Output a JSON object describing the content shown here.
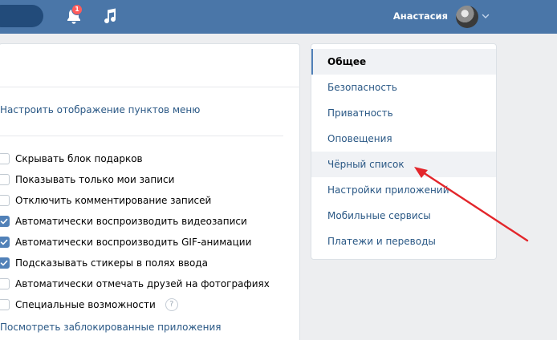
{
  "header": {
    "search_icon": "search-field",
    "notification_count": "1",
    "user_name": "Анастасия",
    "colors": {
      "bar": "#4a76a8",
      "badge": "#ff5c5c"
    }
  },
  "left_panel": {
    "menu_config_link": "Настроить отображение пунктов меню",
    "options": [
      {
        "label": "Скрывать блок подарков",
        "checked": false
      },
      {
        "label": "Показывать только мои записи",
        "checked": false
      },
      {
        "label": "Отключить комментирование записей",
        "checked": false
      },
      {
        "label": "Автоматически воспроизводить видеозаписи",
        "checked": true
      },
      {
        "label": "Автоматически воспроизводить GIF-анимации",
        "checked": true
      },
      {
        "label": "Подсказывать стикеры в полях ввода",
        "checked": true
      },
      {
        "label": "Автоматически отмечать друзей на фотографиях",
        "checked": false
      },
      {
        "label": "Специальные возможности",
        "checked": false
      }
    ],
    "help_glyph": "?",
    "blocked_apps_link": "Посмотреть заблокированные приложения"
  },
  "right_menu": {
    "items": [
      {
        "label": "Общее",
        "state": "active"
      },
      {
        "label": "Безопасность",
        "state": "normal"
      },
      {
        "label": "Приватность",
        "state": "normal"
      },
      {
        "label": "Оповещения",
        "state": "normal"
      },
      {
        "label": "Чёрный список",
        "state": "hover"
      },
      {
        "label": "Настройки приложений",
        "state": "normal"
      },
      {
        "label": "Мобильные сервисы",
        "state": "normal"
      },
      {
        "label": "Платежи и переводы",
        "state": "normal"
      }
    ],
    "annotation_arrow_color": "#e3262b"
  }
}
